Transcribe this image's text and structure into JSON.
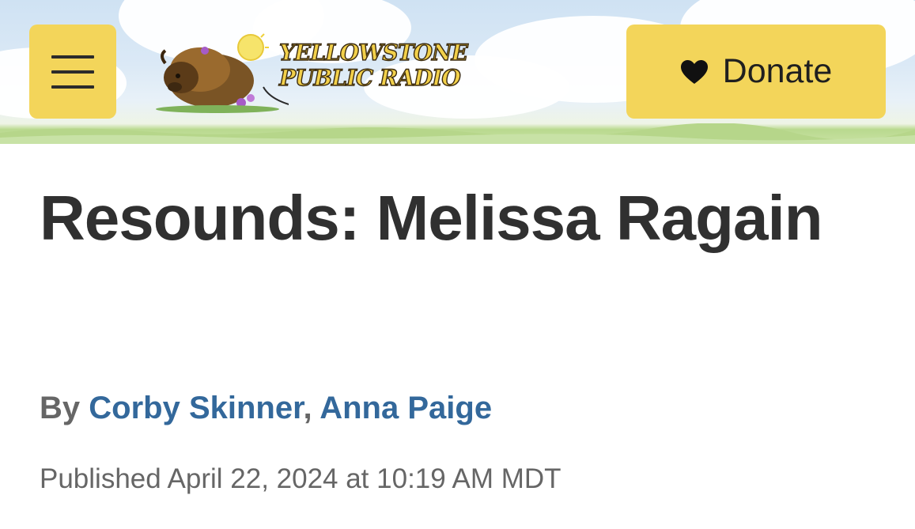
{
  "header": {
    "menu_icon": "hamburger-menu-icon",
    "logo": {
      "line1": "YELLOWSTONE",
      "line2": "PUBLIC RADIO"
    },
    "donate": {
      "icon": "heart-icon",
      "label": "Donate"
    },
    "colors": {
      "button_yellow": "#f3d55a",
      "sky": "#cfe2f3",
      "grass": "#b9d98f"
    }
  },
  "article": {
    "title": "Resounds: Melissa Ragain",
    "byline": {
      "prefix": "By",
      "authors": [
        "Corby Skinner",
        "Anna Paige"
      ],
      "separator": ","
    },
    "published": "Published April 22, 2024 at 10:19 AM MDT",
    "colors": {
      "title": "#303030",
      "author_link": "#33689b",
      "meta": "#666666"
    }
  }
}
